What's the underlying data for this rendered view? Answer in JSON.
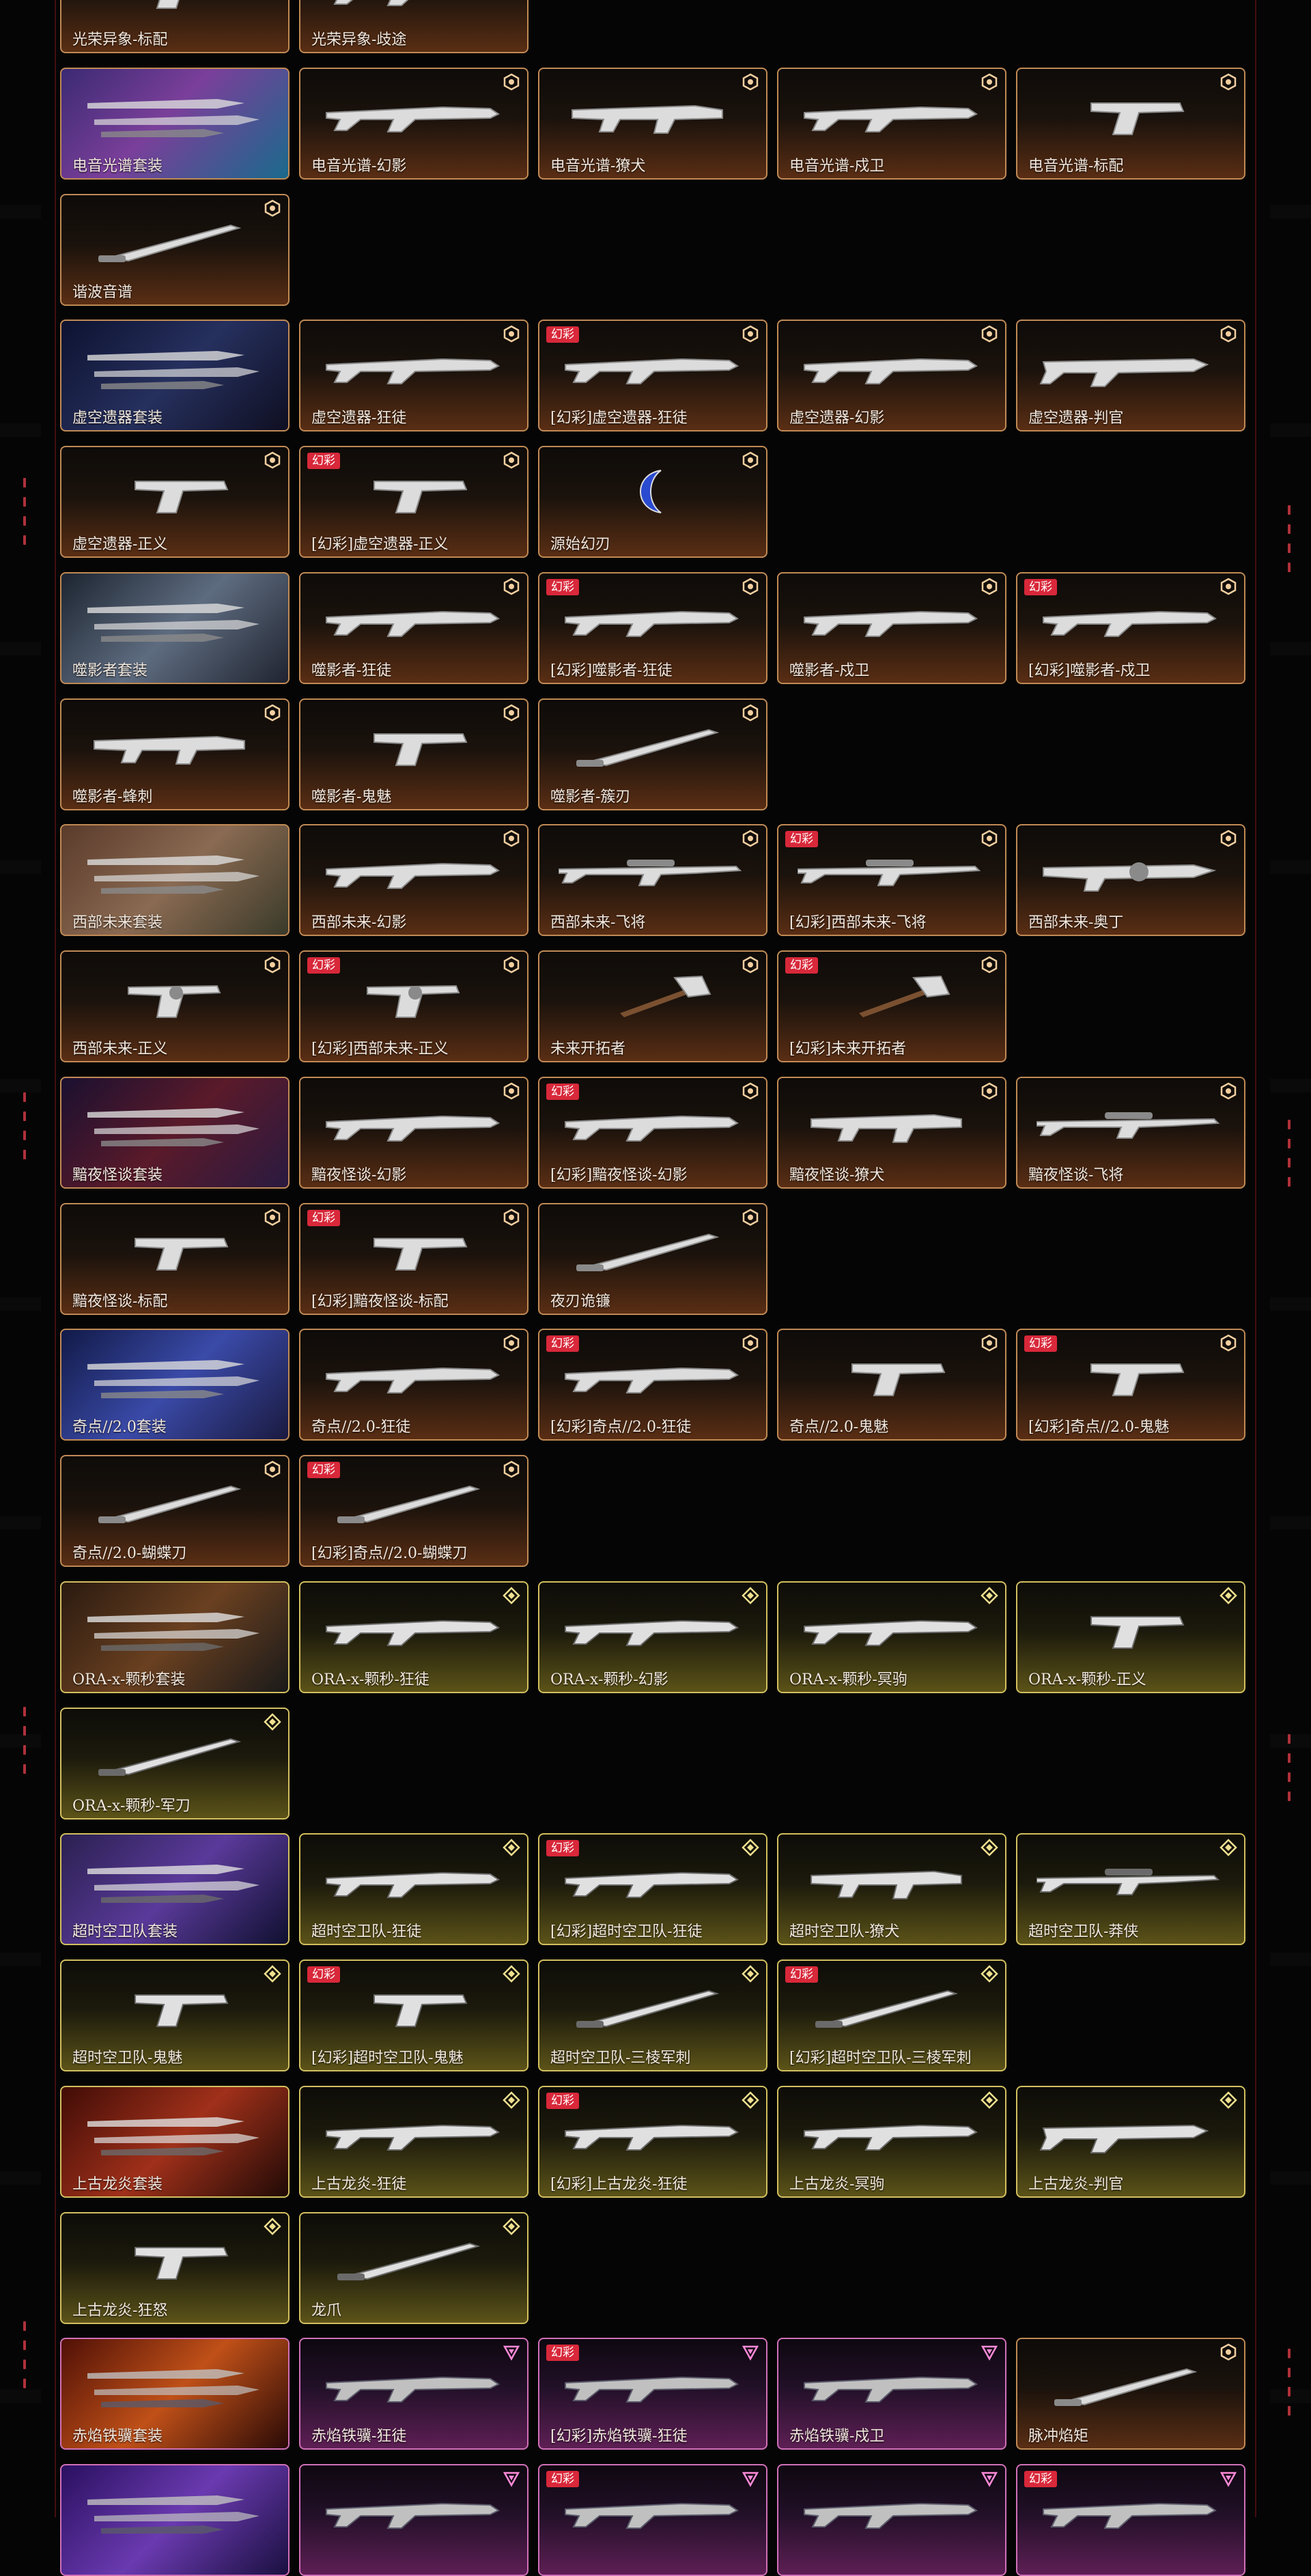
{
  "colors": {
    "premium_border": "#c08a55",
    "exclusive_border": "#d2bf60",
    "ultra_border": "#d070b8",
    "variant_badge": "#d8283a",
    "background": "#050505"
  },
  "variant_badge_label": "幻彩",
  "items": [
    {
      "name": "光荣异象-标配",
      "tier": "premium",
      "type": "pistol"
    },
    {
      "name": "光荣异象-歧途",
      "tier": "premium",
      "type": "rifle"
    },
    {
      "name": "电音光谱套装",
      "tier": "premium",
      "type": "bundle",
      "bundle_style": "b1"
    },
    {
      "name": "电音光谱-幻影",
      "tier": "premium",
      "type": "rifle"
    },
    {
      "name": "电音光谱-獠犬",
      "tier": "premium",
      "type": "smg"
    },
    {
      "name": "电音光谱-戍卫",
      "tier": "premium",
      "type": "rifle"
    },
    {
      "name": "电音光谱-标配",
      "tier": "premium",
      "type": "pistol"
    },
    {
      "name": "谐波音谱",
      "tier": "premium",
      "type": "melee"
    },
    {
      "name": "虚空遗器套装",
      "tier": "premium",
      "type": "bundle",
      "bundle_style": "b2"
    },
    {
      "name": "虚空遗器-狂徒",
      "tier": "premium",
      "type": "rifle"
    },
    {
      "name": "[幻彩]虚空遗器-狂徒",
      "tier": "premium",
      "type": "rifle",
      "variant": true
    },
    {
      "name": "虚空遗器-幻影",
      "tier": "premium",
      "type": "rifle"
    },
    {
      "name": "虚空遗器-判官",
      "tier": "premium",
      "type": "shotgun"
    },
    {
      "name": "虚空遗器-正义",
      "tier": "premium",
      "type": "pistol"
    },
    {
      "name": "[幻彩]虚空遗器-正义",
      "tier": "premium",
      "type": "pistol",
      "variant": true
    },
    {
      "name": "源始幻刃",
      "tier": "premium",
      "type": "blade-round"
    },
    {
      "name": "噬影者套装",
      "tier": "premium",
      "type": "bundle",
      "bundle_style": "b3"
    },
    {
      "name": "噬影者-狂徒",
      "tier": "premium",
      "type": "rifle"
    },
    {
      "name": "[幻彩]噬影者-狂徒",
      "tier": "premium",
      "type": "rifle",
      "variant": true
    },
    {
      "name": "噬影者-戍卫",
      "tier": "premium",
      "type": "rifle"
    },
    {
      "name": "[幻彩]噬影者-戍卫",
      "tier": "premium",
      "type": "rifle",
      "variant": true
    },
    {
      "name": "噬影者-蜂刺",
      "tier": "premium",
      "type": "smg"
    },
    {
      "name": "噬影者-鬼魅",
      "tier": "premium",
      "type": "pistol"
    },
    {
      "name": "噬影者-簇刃",
      "tier": "premium",
      "type": "melee"
    },
    {
      "name": "西部未来套装",
      "tier": "premium",
      "type": "bundle",
      "bundle_style": "b4"
    },
    {
      "name": "西部未来-幻影",
      "tier": "premium",
      "type": "rifle"
    },
    {
      "name": "西部未来-飞将",
      "tier": "premium",
      "type": "sniper"
    },
    {
      "name": "[幻彩]西部未来-飞将",
      "tier": "premium",
      "type": "sniper",
      "variant": true
    },
    {
      "name": "西部未来-奥丁",
      "tier": "premium",
      "type": "heavy"
    },
    {
      "name": "西部未来-正义",
      "tier": "premium",
      "type": "revolver"
    },
    {
      "name": "[幻彩]西部未来-正义",
      "tier": "premium",
      "type": "revolver",
      "variant": true
    },
    {
      "name": "未来开拓者",
      "tier": "premium",
      "type": "axe"
    },
    {
      "name": "[幻彩]未来开拓者",
      "tier": "premium",
      "type": "axe",
      "variant": true
    },
    {
      "name": "黯夜怪谈套装",
      "tier": "premium",
      "type": "bundle",
      "bundle_style": "b5"
    },
    {
      "name": "黯夜怪谈-幻影",
      "tier": "premium",
      "type": "rifle"
    },
    {
      "name": "[幻彩]黯夜怪谈-幻影",
      "tier": "premium",
      "type": "rifle",
      "variant": true
    },
    {
      "name": "黯夜怪谈-獠犬",
      "tier": "premium",
      "type": "smg"
    },
    {
      "name": "黯夜怪谈-飞将",
      "tier": "premium",
      "type": "sniper"
    },
    {
      "name": "黯夜怪谈-标配",
      "tier": "premium",
      "type": "pistol"
    },
    {
      "name": "[幻彩]黯夜怪谈-标配",
      "tier": "premium",
      "type": "pistol",
      "variant": true
    },
    {
      "name": "夜刃诡镰",
      "tier": "premium",
      "type": "melee"
    },
    {
      "name": "奇点//2.0套装",
      "tier": "premium",
      "type": "bundle",
      "bundle_style": "b6"
    },
    {
      "name": "奇点//2.0-狂徒",
      "tier": "premium",
      "type": "rifle"
    },
    {
      "name": "[幻彩]奇点//2.0-狂徒",
      "tier": "premium",
      "type": "rifle",
      "variant": true
    },
    {
      "name": "奇点//2.0-鬼魅",
      "tier": "premium",
      "type": "pistol"
    },
    {
      "name": "[幻彩]奇点//2.0-鬼魅",
      "tier": "premium",
      "type": "pistol",
      "variant": true
    },
    {
      "name": "奇点//2.0-蝴蝶刀",
      "tier": "premium",
      "type": "melee"
    },
    {
      "name": "[幻彩]奇点//2.0-蝴蝶刀",
      "tier": "premium",
      "type": "melee",
      "variant": true
    },
    {
      "name": "ORA-x-颗秒套装",
      "tier": "exclusive",
      "type": "bundle",
      "bundle_style": "b7"
    },
    {
      "name": "ORA-x-颗秒-狂徒",
      "tier": "exclusive",
      "type": "rifle"
    },
    {
      "name": "ORA-x-颗秒-幻影",
      "tier": "exclusive",
      "type": "rifle"
    },
    {
      "name": "ORA-x-颗秒-冥驹",
      "tier": "exclusive",
      "type": "rifle"
    },
    {
      "name": "ORA-x-颗秒-正义",
      "tier": "exclusive",
      "type": "pistol"
    },
    {
      "name": "ORA-x-颗秒-军刀",
      "tier": "exclusive",
      "type": "melee"
    },
    {
      "name": "超时空卫队套装",
      "tier": "exclusive",
      "type": "bundle",
      "bundle_style": "b8"
    },
    {
      "name": "超时空卫队-狂徒",
      "tier": "exclusive",
      "type": "rifle"
    },
    {
      "name": "[幻彩]超时空卫队-狂徒",
      "tier": "exclusive",
      "type": "rifle",
      "variant": true
    },
    {
      "name": "超时空卫队-獠犬",
      "tier": "exclusive",
      "type": "smg"
    },
    {
      "name": "超时空卫队-莽侠",
      "tier": "exclusive",
      "type": "sniper"
    },
    {
      "name": "超时空卫队-鬼魅",
      "tier": "exclusive",
      "type": "pistol"
    },
    {
      "name": "[幻彩]超时空卫队-鬼魅",
      "tier": "exclusive",
      "type": "pistol",
      "variant": true
    },
    {
      "name": "超时空卫队-三棱军刺",
      "tier": "exclusive",
      "type": "melee"
    },
    {
      "name": "[幻彩]超时空卫队-三棱军刺",
      "tier": "exclusive",
      "type": "melee",
      "variant": true
    },
    {
      "name": "上古龙炎套装",
      "tier": "exclusive",
      "type": "bundle",
      "bundle_style": "b9"
    },
    {
      "name": "上古龙炎-狂徒",
      "tier": "exclusive",
      "type": "rifle"
    },
    {
      "name": "[幻彩]上古龙炎-狂徒",
      "tier": "exclusive",
      "type": "rifle",
      "variant": true
    },
    {
      "name": "上古龙炎-冥驹",
      "tier": "exclusive",
      "type": "rifle"
    },
    {
      "name": "上古龙炎-判官",
      "tier": "exclusive",
      "type": "shotgun"
    },
    {
      "name": "上古龙炎-狂怒",
      "tier": "exclusive",
      "type": "pistol"
    },
    {
      "name": "龙爪",
      "tier": "exclusive",
      "type": "melee"
    },
    {
      "name": "赤焰铁骥套装",
      "tier": "ultra",
      "type": "bundle",
      "bundle_style": "b10"
    },
    {
      "name": "赤焰铁骥-狂徒",
      "tier": "ultra",
      "type": "rifle"
    },
    {
      "name": "[幻彩]赤焰铁骥-狂徒",
      "tier": "ultra",
      "type": "rifle",
      "variant": true
    },
    {
      "name": "赤焰铁骥-戍卫",
      "tier": "ultra",
      "type": "rifle"
    },
    {
      "name": "脉冲焰矩",
      "tier": "premium",
      "type": "melee"
    },
    {
      "name": "",
      "tier": "ultra",
      "type": "bundle",
      "bundle_style": "b11"
    },
    {
      "name": "",
      "tier": "ultra",
      "type": "rifle"
    },
    {
      "name": "",
      "tier": "ultra",
      "type": "rifle",
      "variant": true
    },
    {
      "name": "",
      "tier": "ultra",
      "type": "rifle"
    },
    {
      "name": "",
      "tier": "ultra",
      "type": "rifle",
      "variant": true
    }
  ]
}
